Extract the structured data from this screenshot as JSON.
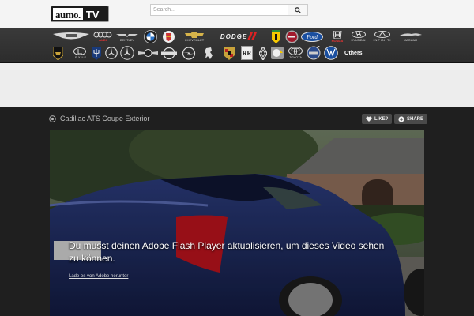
{
  "header": {
    "logo_left": "aumo.",
    "logo_right": "TV",
    "search_placeholder": "Search..."
  },
  "brands": {
    "row1": [
      "Aston Martin",
      "Audi",
      "Bentley",
      "BMW",
      "Cadillac",
      "Chevrolet",
      "Dodge",
      "Ferrari",
      "Fiat",
      "Ford",
      "Honda",
      "Hyundai",
      "Infiniti",
      "Jaguar"
    ],
    "row2": [
      "Lamborghini",
      "Lexus",
      "Maserati",
      "Mercedes",
      "Mini",
      "Nissan",
      "Opel",
      "Peugeot",
      "Porsche",
      "Rolls-Royce",
      "Smart",
      "Toyota",
      "Volvo",
      "VW"
    ],
    "wordmarks": {
      "audi": "AUDI",
      "bentley": "BENTLEY",
      "chevrolet": "CHEVROLET",
      "dodge": "DODGE",
      "honda": "HONDA",
      "hyundai": "HYUNDAI",
      "infiniti": "INFINITI",
      "jaguar": "JAGUAR",
      "lexus": "LEXUS",
      "toyota": "TOYOTA"
    },
    "others_label": "Others"
  },
  "video": {
    "title": "Cadillac ATS Coupe Exterior",
    "like_label": "LIKE?",
    "share_label": "SHARE",
    "flash_message": "Du musst deinen Adobe Flash Player aktualisieren, um dieses Video sehen zu können.",
    "flash_link": "Lade es von Adobe herunter"
  },
  "colors": {
    "brand_bar": "#333333",
    "video_bg": "#1f1f1f",
    "car_blue": "#1d2a5c"
  }
}
